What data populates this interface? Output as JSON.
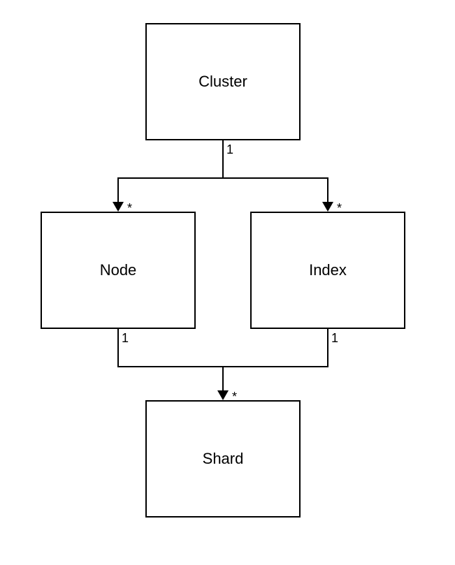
{
  "nodes": {
    "cluster": {
      "label": "Cluster"
    },
    "node": {
      "label": "Node"
    },
    "index": {
      "label": "Index"
    },
    "shard": {
      "label": "Shard"
    }
  },
  "multiplicity": {
    "one": "1",
    "many": "*"
  }
}
